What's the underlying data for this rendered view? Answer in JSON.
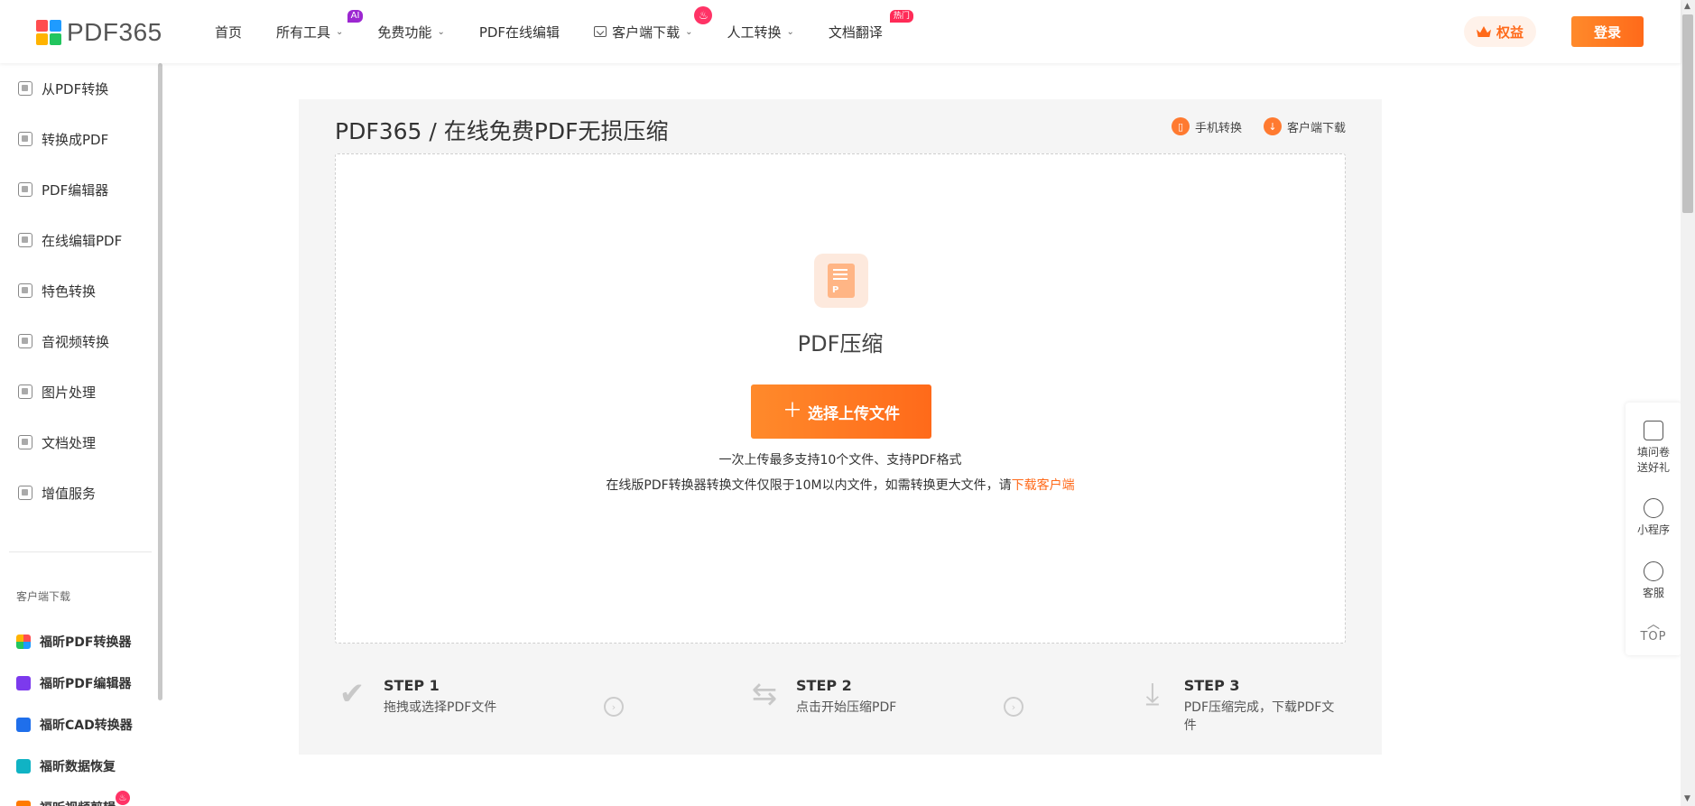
{
  "header": {
    "logo_text": "PDF365",
    "logo_colors": [
      "#ff4d4f",
      "#1f9bff",
      "#ffb300",
      "#22c55e"
    ],
    "nav": [
      {
        "label": "首页"
      },
      {
        "label": "所有工具",
        "badge": "AI"
      },
      {
        "label": "免费功能"
      },
      {
        "label": "PDF在线编辑"
      },
      {
        "label": "客户端下载"
      },
      {
        "label": "人工转换"
      },
      {
        "label": "文档翻译",
        "badge": "热门"
      }
    ],
    "benefit_label": "权益",
    "login_label": "登录"
  },
  "sidebar": {
    "items": [
      {
        "label": "从PDF转换"
      },
      {
        "label": "转换成PDF"
      },
      {
        "label": "PDF编辑器"
      },
      {
        "label": "在线编辑PDF"
      },
      {
        "label": "特色转换"
      },
      {
        "label": "音视频转换"
      },
      {
        "label": "图片处理"
      },
      {
        "label": "文档处理"
      },
      {
        "label": "增值服务"
      }
    ],
    "section_title": "客户端下载",
    "apps": [
      {
        "label": "福昕PDF转换器",
        "color": "#ff6a1a"
      },
      {
        "label": "福昕PDF编辑器",
        "color": "#7c3aed"
      },
      {
        "label": "福昕CAD转换器",
        "color": "#1f6feb"
      },
      {
        "label": "福昕数据恢复",
        "color": "#10b3c4"
      },
      {
        "label": "福昕视频剪辑",
        "color": "#ff7a00"
      }
    ]
  },
  "main": {
    "breadcrumb": "PDF365 / 在线免费PDF无损压缩",
    "mobile_link": "手机转换",
    "client_link": "客户端下载",
    "tool_title": "PDF压缩",
    "upload_label": "选择上传文件",
    "hint1": "一次上传最多支持10个文件、支持PDF格式",
    "hint2_prefix": "在线版PDF转换器转换文件仅限于10M以内文件，如需转换更大文件，请",
    "hint2_link": "下载客户端",
    "steps": [
      {
        "title": "STEP 1",
        "desc": "拖拽或选择PDF文件"
      },
      {
        "title": "STEP 2",
        "desc": "点击开始压缩PDF"
      },
      {
        "title": "STEP 3",
        "desc": "PDF压缩完成，下载PDF文件"
      }
    ]
  },
  "float_bar": {
    "survey_line1": "填问卷",
    "survey_line2": "送好礼",
    "miniapp": "小程序",
    "service": "客服",
    "top": "TOP"
  },
  "colors": {
    "accent": "#ff6a1a",
    "panel_bg": "#f5f5f5"
  }
}
